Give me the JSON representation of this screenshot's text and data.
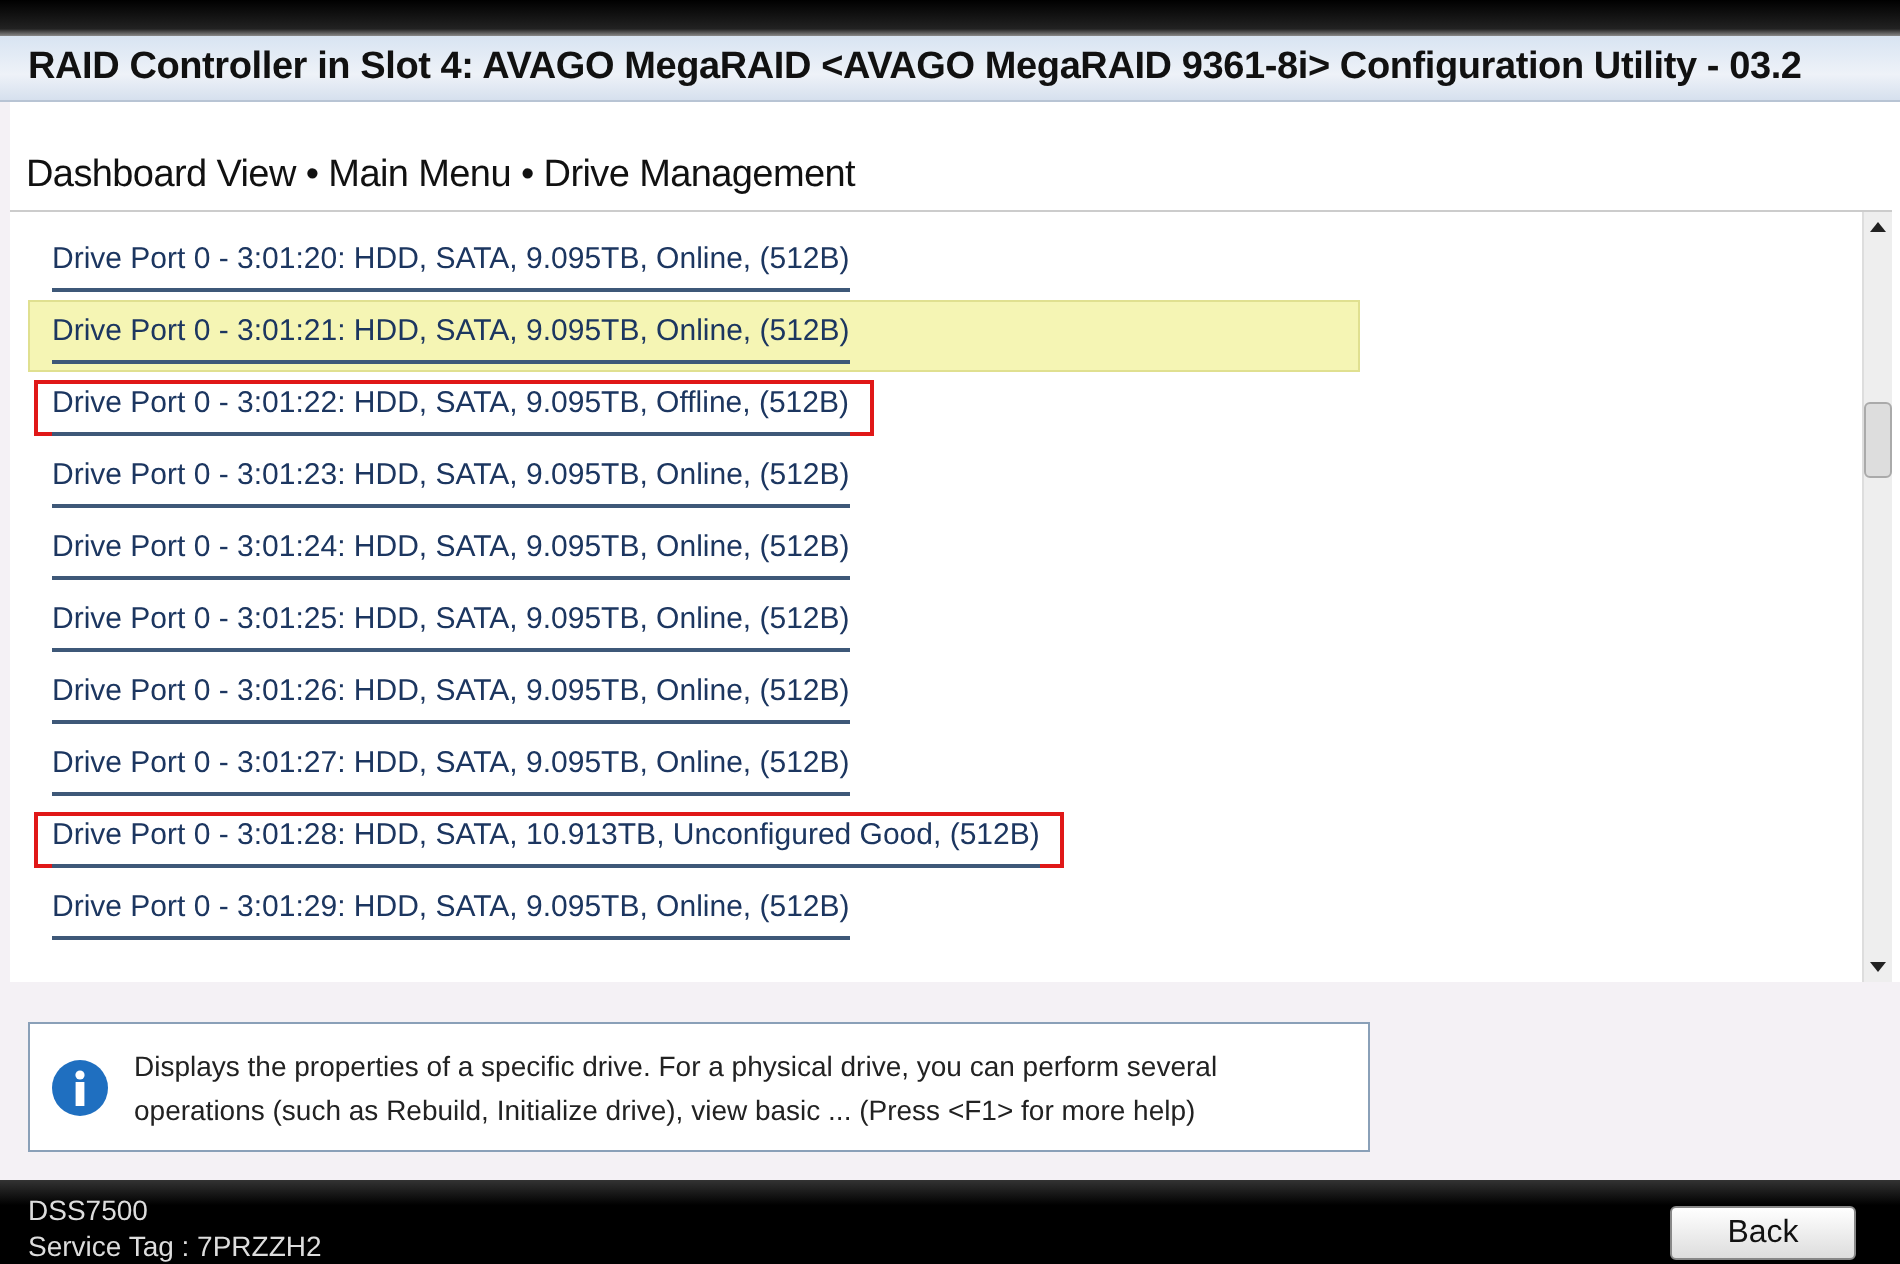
{
  "window": {
    "title": "RAID Controller in Slot 4: AVAGO MegaRAID <AVAGO MegaRAID 9361-8i> Configuration Utility - 03.2"
  },
  "breadcrumb": "Dashboard View • Main Menu • Drive Management",
  "drives": [
    {
      "label": "Drive Port 0 - 3:01:20: HDD, SATA, 9.095TB, Online, (512B)",
      "selected": false,
      "marked": false
    },
    {
      "label": "Drive Port 0 - 3:01:21: HDD, SATA, 9.095TB, Online, (512B)",
      "selected": true,
      "marked": false
    },
    {
      "label": "Drive Port 0 - 3:01:22: HDD, SATA, 9.095TB, Offline, (512B)",
      "selected": false,
      "marked": true
    },
    {
      "label": "Drive Port 0 - 3:01:23: HDD, SATA, 9.095TB, Online, (512B)",
      "selected": false,
      "marked": false
    },
    {
      "label": "Drive Port 0 - 3:01:24: HDD, SATA, 9.095TB, Online, (512B)",
      "selected": false,
      "marked": false
    },
    {
      "label": "Drive Port 0 - 3:01:25: HDD, SATA, 9.095TB, Online, (512B)",
      "selected": false,
      "marked": false
    },
    {
      "label": "Drive Port 0 - 3:01:26: HDD, SATA, 9.095TB, Online, (512B)",
      "selected": false,
      "marked": false
    },
    {
      "label": "Drive Port 0 - 3:01:27: HDD, SATA, 9.095TB, Online, (512B)",
      "selected": false,
      "marked": false
    },
    {
      "label": "Drive Port 0 - 3:01:28: HDD, SATA, 10.913TB, Unconfigured Good, (512B)",
      "selected": false,
      "marked": true
    },
    {
      "label": "Drive Port 0 - 3:01:29: HDD, SATA, 9.095TB, Online, (512B)",
      "selected": false,
      "marked": false
    }
  ],
  "help": {
    "text": "Displays the properties of a specific drive. For a physical drive, you can perform several operations (such as Rebuild, Initialize drive), view basic ... (Press <F1> for more help)"
  },
  "footer": {
    "model": "DSS7500",
    "service_tag": "Service Tag : 7PRZZH2",
    "button": "Back"
  }
}
